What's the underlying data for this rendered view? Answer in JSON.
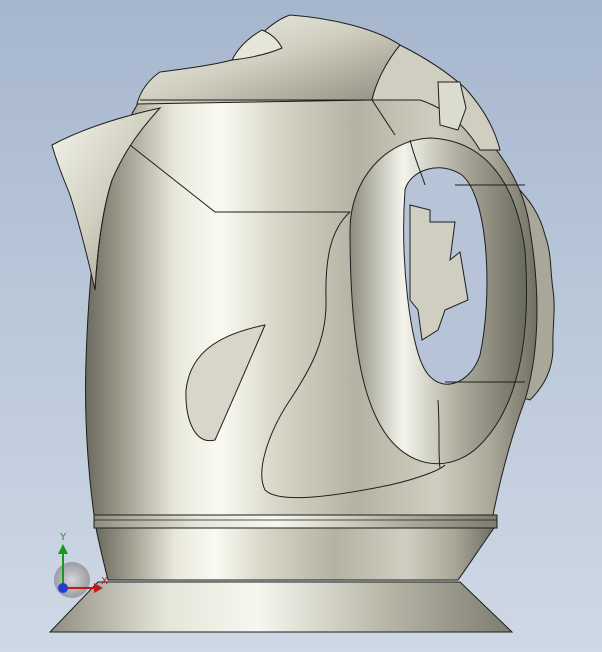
{
  "view": {
    "background_top": "#a6b6cd",
    "background_bottom": "#cfd8e5"
  },
  "model": {
    "object": "electric-kettle",
    "display_mode": "shaded-with-edges",
    "body_color": "#c9c8b8",
    "edge_color": "#1e1e1e"
  },
  "triad": {
    "y_label": "Y",
    "x_label": "X",
    "y_color": "#1a9a1a",
    "x_color": "#c21a1a",
    "z_color": "#1f3fd0"
  }
}
